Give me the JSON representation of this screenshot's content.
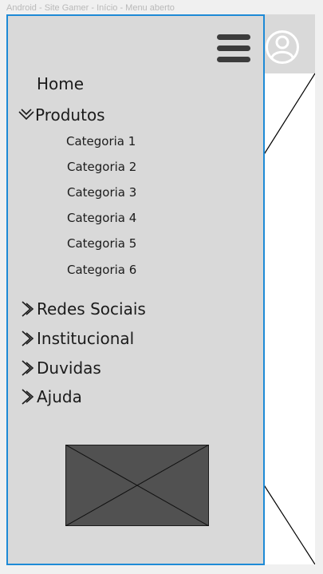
{
  "frame": {
    "title": "Android - Site Gamer - Início - Menu aberto"
  },
  "header": {
    "menu_icon": "hamburger-icon",
    "user_icon": "user-circle-icon"
  },
  "menu": {
    "home": "Home",
    "produtos": "Produtos",
    "categories": [
      "Categoria 1",
      "Categoria 2",
      "Categoria 3",
      "Categoria 4",
      "Categoria 5",
      "Categoria 6"
    ],
    "redes_sociais": "Redes Sociais",
    "institucional": "Institucional",
    "duvidas": "Duvidas",
    "ajuda": "Ajuda"
  },
  "colors": {
    "drawer_bg": "#d9d9d9",
    "drawer_border": "#1e8ad6",
    "placeholder": "#515151"
  }
}
